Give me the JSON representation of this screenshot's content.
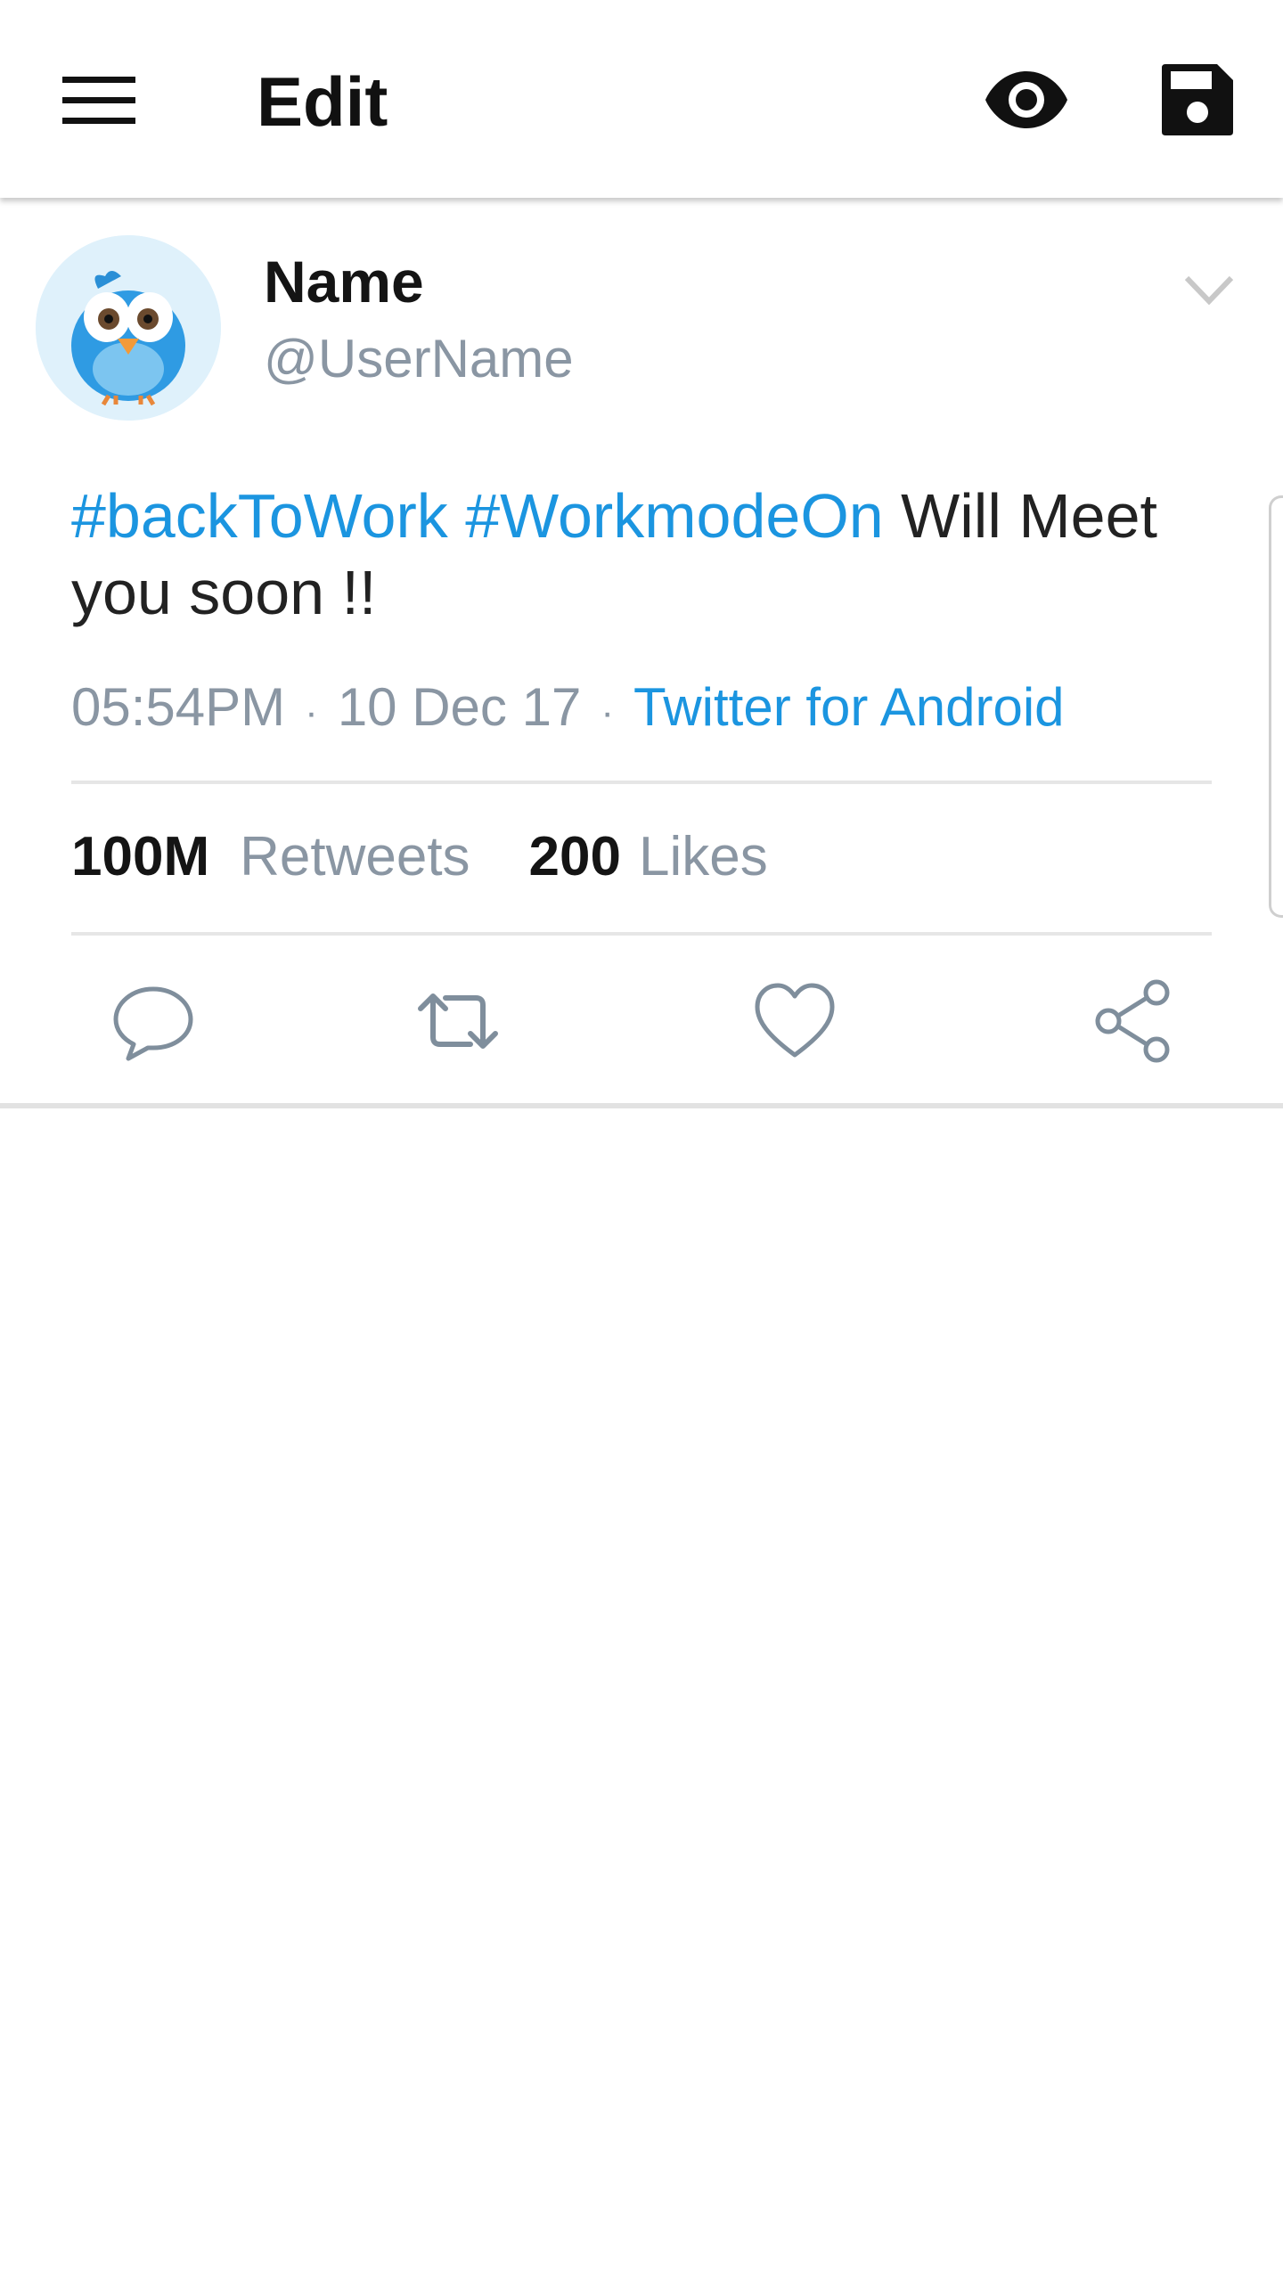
{
  "appbar": {
    "title": "Edit",
    "icons": [
      "menu-icon",
      "eye-icon",
      "save-icon"
    ]
  },
  "tweet": {
    "name": "Name",
    "handle": "@UserName",
    "text": {
      "tag1": "#backToWork",
      "tag2": "#WorkmodeOn",
      "body": "Will Meet you soon !!"
    },
    "time": "05:54PM",
    "date": "10 Dec 17",
    "source": "Twitter for Android",
    "separator": "·",
    "retweets_count": "100M",
    "retweets_label": "Retweets",
    "likes_count": "200",
    "likes_label": "Likes",
    "actions": [
      "reply-icon",
      "retweet-icon",
      "like-icon",
      "share-icon"
    ]
  },
  "colors": {
    "link": "#1b95e0",
    "muted": "#8a96a3",
    "text": "#222222"
  }
}
